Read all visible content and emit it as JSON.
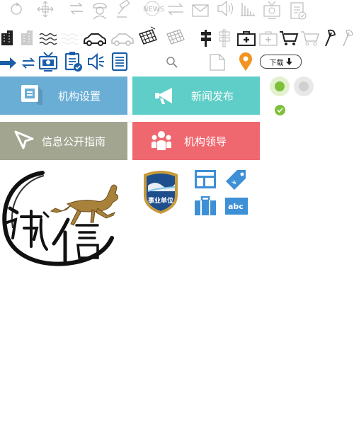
{
  "colors": {
    "tile_org_settings": "#6aaed6",
    "tile_news_publish": "#60cec8",
    "tile_info_guide": "#a2a58f",
    "tile_org_leaders": "#f0686f",
    "icon_blue": "#1b5ea8",
    "icon_gray": "#9a9a9a",
    "icon_black": "#222222",
    "location_orange": "#f39420",
    "radio_green": "#7ec03a",
    "app_icon_blue": "#3d8fd6"
  },
  "tiles": {
    "org_settings": "机构设置",
    "news_publish": "新闻发布",
    "info_guide": "信息公开指南",
    "org_leaders": "机构领导"
  },
  "download_button": {
    "label": "下载"
  },
  "badge": {
    "label": "事业单位"
  },
  "calligraphy": {
    "text": "诚信"
  },
  "icons": {
    "row1": [
      "refresh-icon",
      "move-arrows-icon",
      "swap-icon",
      "police-avatar-icon",
      "gavel-icon",
      "news-icon",
      "transfer-arrows-icon",
      "mail-icon",
      "speaker-icon",
      "bar-chart-icon",
      "tv-icon",
      "clipboard-check-icon"
    ],
    "row2": [
      "building-icon",
      "building-outline-icon",
      "water-waves-icon",
      "water-waves-faint-icon",
      "car-icon",
      "car-outline-icon",
      "solar-panel-icon",
      "solar-panel-outline-icon",
      "signpost-icon",
      "signpost-outline-icon",
      "medical-kit-icon",
      "medical-kit-outline-icon",
      "shopping-cart-icon",
      "shopping-cart-outline-icon",
      "axe-icon",
      "axe-outline-icon"
    ],
    "row3": [
      "arrow-right-icon",
      "swap-arrows-icon",
      "tv-icon",
      "clipboard-check-icon",
      "speaker-icon",
      "document-list-icon",
      "search-icon",
      "blank-page-icon",
      "location-pin-icon"
    ],
    "app": [
      "layout-icon",
      "price-tag-icon",
      "briefcase-icon",
      "abc-icon"
    ]
  }
}
